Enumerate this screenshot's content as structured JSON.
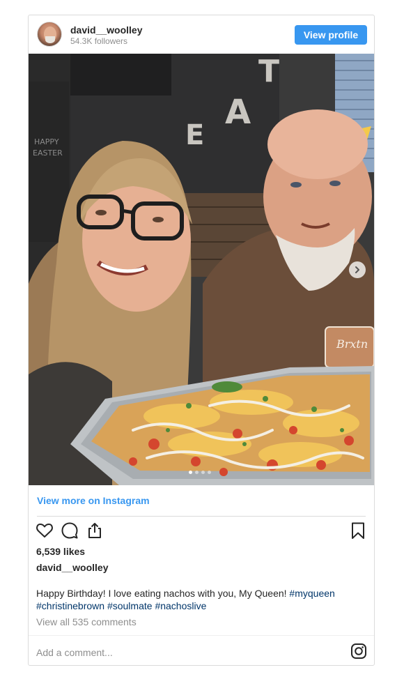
{
  "header": {
    "username": "david__woolley",
    "followers": "54.3K followers",
    "view_profile_label": "View profile"
  },
  "photo": {
    "dots_total": 4,
    "dots_active_index": 0
  },
  "body": {
    "view_more_label": "View more on Instagram",
    "likes": "6,539 likes",
    "owner": "david__woolley",
    "caption_text": "Happy Birthday! I love eating nachos with you, My Queen! ",
    "hashtags": [
      "#myqueen",
      "#christinebrown",
      "#soulmate",
      "#nachoslive"
    ],
    "comments_label": "View all 535 comments",
    "add_comment_placeholder": "Add a comment..."
  },
  "icons": [
    "heart-icon",
    "comment-icon",
    "share-icon",
    "bookmark-icon",
    "chevron-right-icon",
    "instagram-icon"
  ],
  "colors": {
    "accent": "#3897f0",
    "hashtag": "#003569",
    "muted": "#8e8e8e",
    "border": "#dbdbdb"
  }
}
